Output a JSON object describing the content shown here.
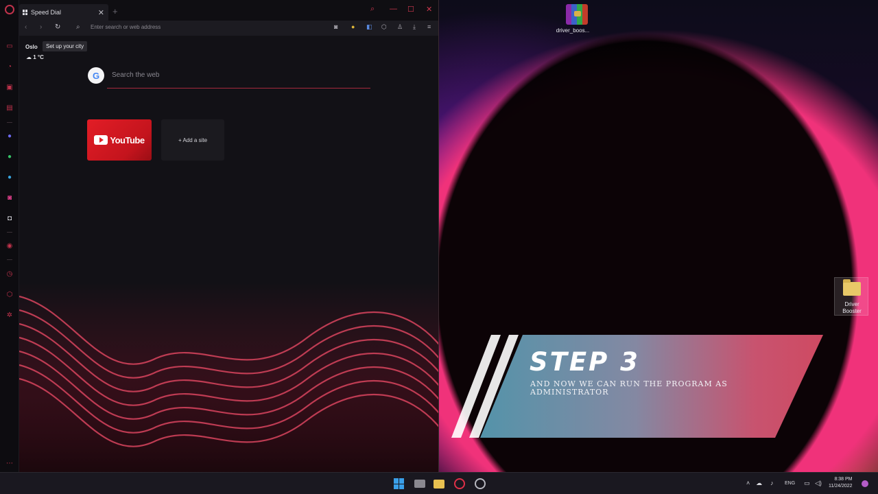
{
  "browser": {
    "tab_title": "Speed Dial",
    "address_placeholder": "Enter search or web address",
    "city": "Oslo",
    "city_tooltip": "Set up your city",
    "weather": "1 °C",
    "search_placeholder": "Search the web",
    "speed_dial": [
      {
        "label": "YouTube"
      },
      {
        "label": "+ Add a site"
      }
    ],
    "accent_color": "#d0384f"
  },
  "desktop": {
    "icons": [
      {
        "label": "driver_boos..."
      },
      {
        "label": "Driver Booster"
      }
    ]
  },
  "overlay": {
    "step_title": "STEP 3",
    "step_subtitle": "AND NOW WE CAN RUN THE PROGRAM AS ADMINISTRATOR"
  },
  "taskbar": {
    "language": "ENG",
    "time": "8:38 PM",
    "date": "11/24/2022"
  }
}
